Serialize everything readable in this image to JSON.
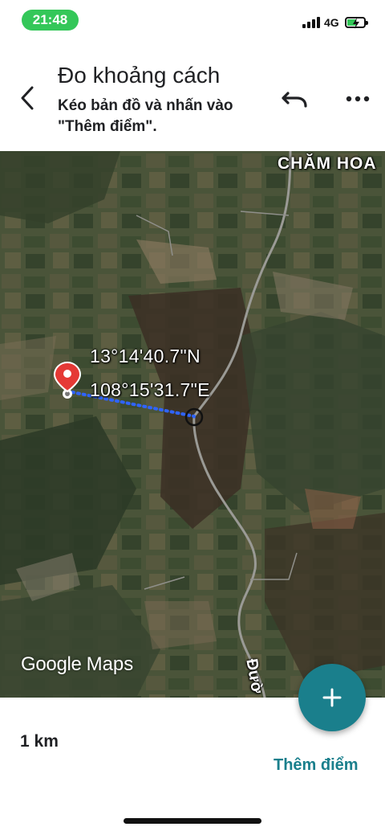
{
  "status_bar": {
    "time": "21:48",
    "network": "4G",
    "colors": {
      "time_pill": "#34c759",
      "battery_fill": "#34c759"
    }
  },
  "header": {
    "title": "Đo khoảng cách",
    "subtitle": "Kéo bản đồ và nhấn vào \"Thêm điểm\".",
    "icons": {
      "back": "back-arrow-icon",
      "undo": "undo-icon",
      "more": "more-horizontal-icon"
    }
  },
  "map": {
    "place_label": "CHĂM HOA",
    "road_label": "Đườ",
    "latitude": "13°14'40.7\"N",
    "longitude": "108°15'31.7\"E",
    "logo_google": "Google",
    "logo_maps": "Maps",
    "icons": {
      "pin": "location-pin-icon",
      "crosshair": "crosshair-icon"
    }
  },
  "bottom": {
    "distance": "1 km",
    "add_point_label": "Thêm điểm",
    "fab_icon": "plus-icon",
    "accent_color": "#1a7f8c"
  }
}
